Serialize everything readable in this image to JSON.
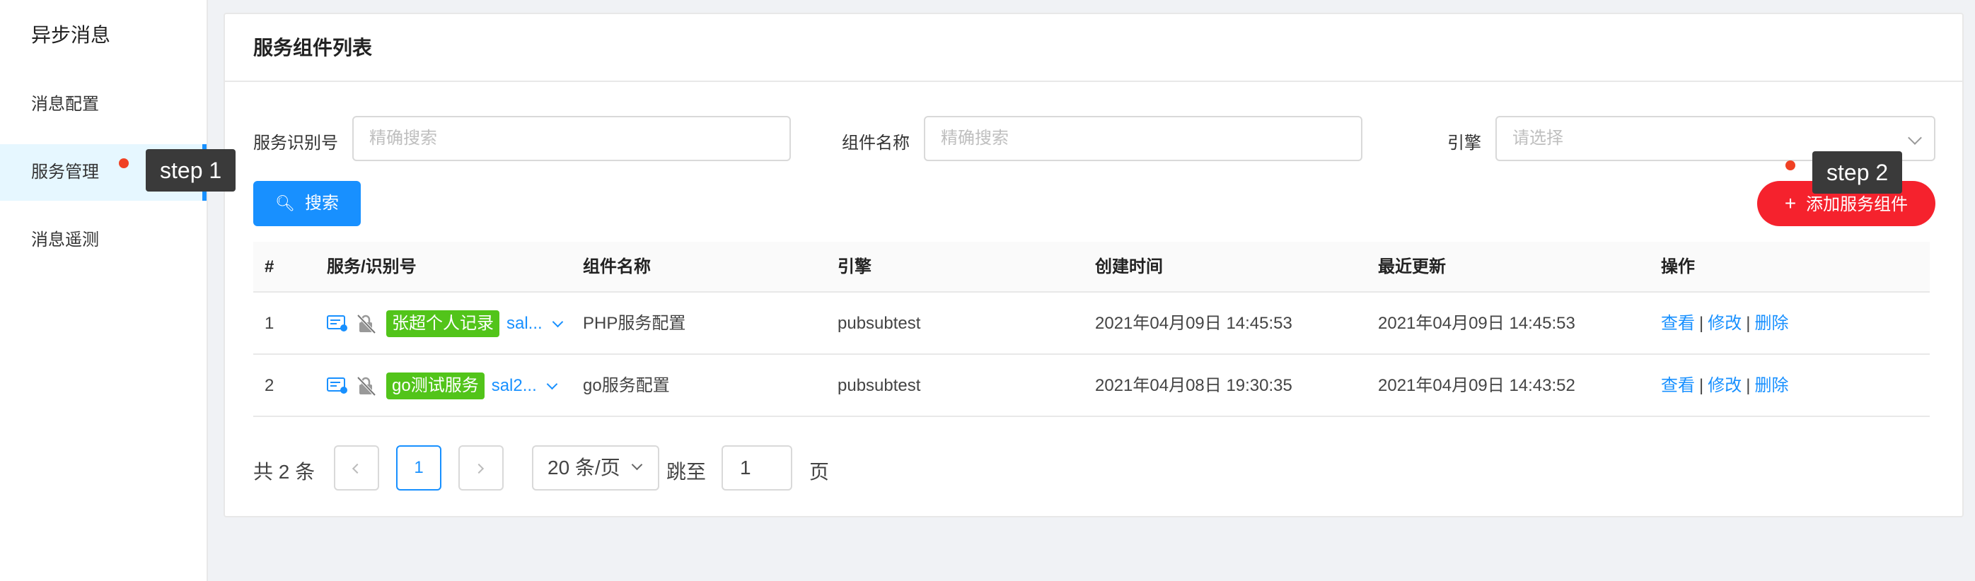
{
  "sidebar": {
    "title": "异步消息",
    "items": [
      {
        "label": "消息配置"
      },
      {
        "label": "服务管理"
      },
      {
        "label": "消息遥测"
      }
    ]
  },
  "card": {
    "title": "服务组件列表"
  },
  "filters": {
    "service_id": {
      "label": "服务识别号",
      "placeholder": "精确搜索"
    },
    "component_name": {
      "label": "组件名称",
      "placeholder": "精确搜索"
    },
    "engine": {
      "label": "引擎",
      "placeholder": "请选择"
    }
  },
  "buttons": {
    "search": "搜索",
    "add": "添加服务组件"
  },
  "table": {
    "headers": [
      "#",
      "服务/识别号",
      "组件名称",
      "引擎",
      "创建时间",
      "最近更新",
      "操作"
    ],
    "rows": [
      {
        "index": "1",
        "service_tag": "张超个人记录",
        "service_id": "sal...",
        "component": "PHP服务配置",
        "engine": "pubsubtest",
        "created": "2021年04月09日 14:45:53",
        "updated": "2021年04月09日 14:45:53",
        "ops": [
          "查看",
          "修改",
          "删除"
        ]
      },
      {
        "index": "2",
        "service_tag": "go测试服务",
        "service_id": "sal2...",
        "component": "go服务配置",
        "engine": "pubsubtest",
        "created": "2021年04月08日 19:30:35",
        "updated": "2021年04月09日 14:43:52",
        "ops": [
          "查看",
          "修改",
          "删除"
        ]
      }
    ],
    "op_separator": "|"
  },
  "pagination": {
    "total": "共 2 条",
    "current_page": "1",
    "page_size": "20 条/页",
    "jump_label": "跳至",
    "jump_value": "1",
    "page_suffix": "页"
  },
  "annotations": {
    "step1": "step 1",
    "step2": "step 2"
  },
  "colors": {
    "primary": "#1890ff",
    "danger": "#f5222d",
    "tag_green": "#52c41a",
    "step_dot": "#f04124"
  }
}
